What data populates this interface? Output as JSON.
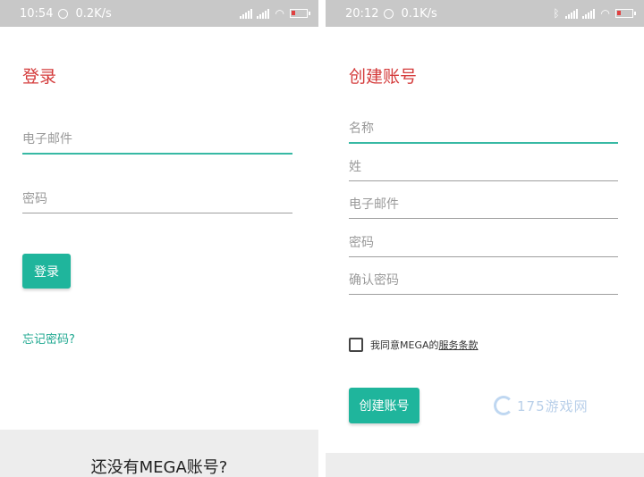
{
  "left": {
    "status": {
      "time": "10:54",
      "speed": "0.2K/s"
    },
    "title": "登录",
    "fields": [
      {
        "placeholder": "电子邮件"
      },
      {
        "placeholder": "密码"
      }
    ],
    "login_button": "登录",
    "forgot_link": "忘记密码?",
    "no_account": "还没有MEGA账号?"
  },
  "right": {
    "status": {
      "time": "20:12",
      "speed": "0.1K/s"
    },
    "title": "创建账号",
    "fields": [
      {
        "placeholder": "名称"
      },
      {
        "placeholder": "姓"
      },
      {
        "placeholder": "电子邮件"
      },
      {
        "placeholder": "密码"
      },
      {
        "placeholder": "确认密码"
      }
    ],
    "terms_prefix": "我同意MEGA的",
    "terms_link": "服务条款",
    "create_button": "创建账号",
    "watermark": "175游戏网"
  },
  "colors": {
    "accent": "#1fb59c",
    "title": "#d43b3b",
    "statusbar": "#c8c8c8"
  }
}
